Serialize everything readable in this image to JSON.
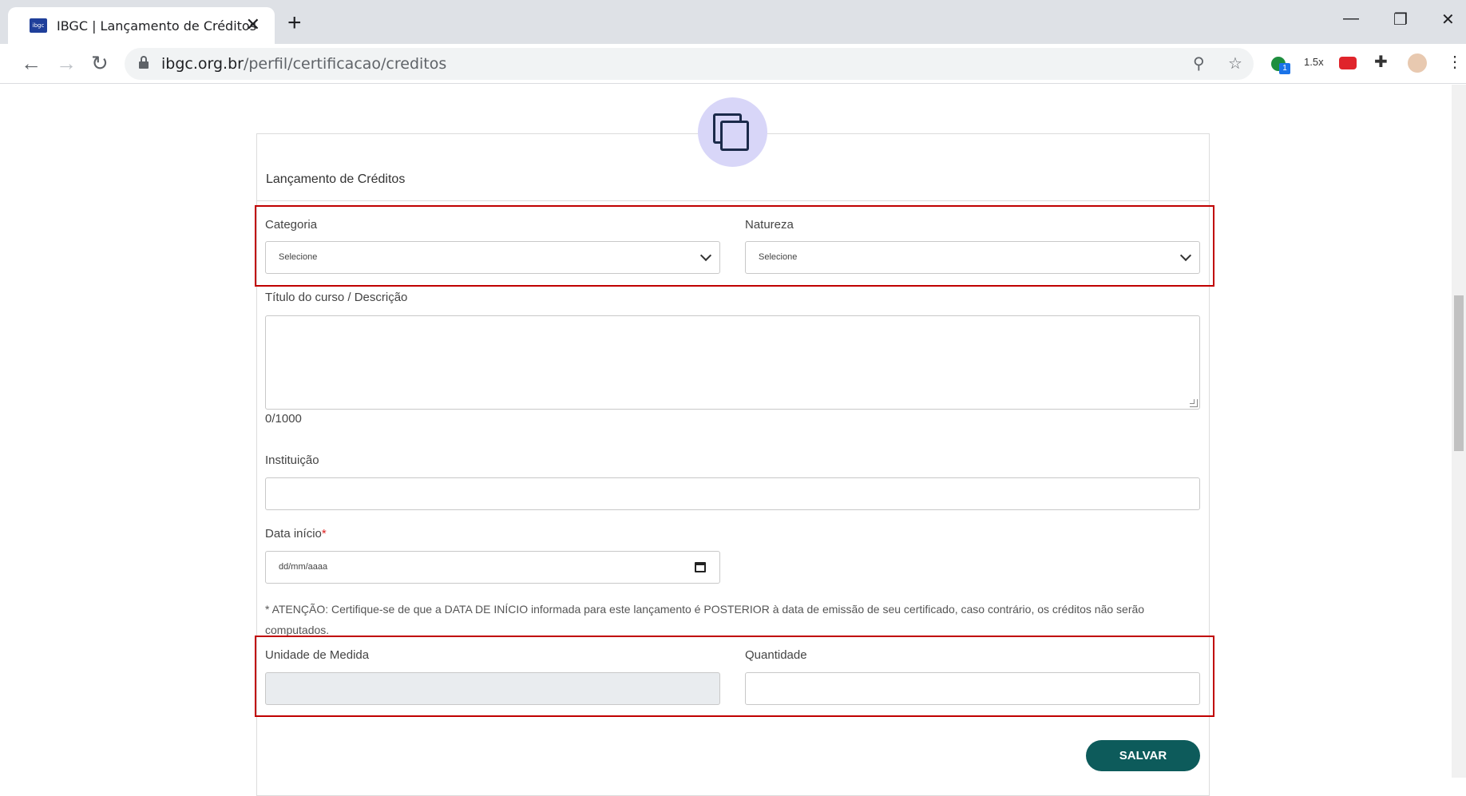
{
  "browser": {
    "tab_title": "IBGC | Lançamento de Créditos",
    "favicon_text": "ibgc",
    "tab_close": "✕",
    "new_tab": "+",
    "url_host": "ibgc.org.br",
    "url_path": "/perfil/certificacao/creditos",
    "speed_label": "1.5x",
    "ext_badge": "1"
  },
  "form": {
    "title": "Lançamento de Créditos",
    "categoria_label": "Categoria",
    "categoria_value": "Selecione",
    "natureza_label": "Natureza",
    "natureza_value": "Selecione",
    "titulo_label": "Título do curso / Descrição",
    "titulo_counter": "0/1000",
    "instituicao_label": "Instituição",
    "data_label": "Data início",
    "data_required": "*",
    "data_placeholder": "dd/mm/aaaa",
    "note": "* ATENÇÃO: Certifique-se de que a DATA DE INÍCIO informada para este lançamento é POSTERIOR à data de emissão de seu certificado, caso contrário, os créditos não serão computados.",
    "unidade_label": "Unidade de Medida",
    "quantidade_label": "Quantidade",
    "save_label": "SALVAR"
  },
  "colors": {
    "highlight": "#c00000",
    "save_button": "#0d5b5b",
    "badge": "#d8d6f8"
  },
  "icons": [
    "copy-icon",
    "calendar-icon",
    "chevron-down-icon",
    "lock-icon",
    "back-icon",
    "forward-icon",
    "reload-icon",
    "zoom-icon",
    "star-icon",
    "puzzle-icon",
    "menu-icon"
  ]
}
